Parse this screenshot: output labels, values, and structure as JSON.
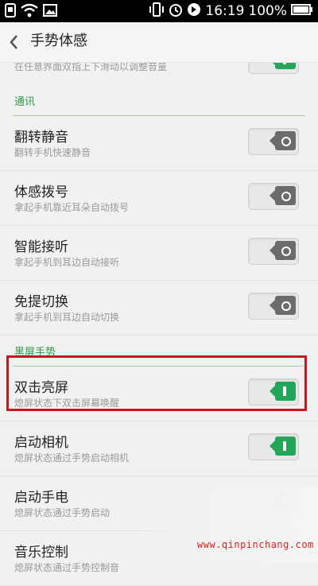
{
  "statusbar": {
    "time": "16:19",
    "battery_text": "100%"
  },
  "header": {
    "title": "手势体感"
  },
  "partial_row": {
    "subtitle": "在任意界面双指上下滑动以调整音量"
  },
  "sections": [
    {
      "label": "通讯",
      "rows": [
        {
          "title": "翻转静音",
          "subtitle": "翻转手机快速静音",
          "enabled": false
        },
        {
          "title": "体感拨号",
          "subtitle": "拿起手机靠近耳朵自动拨号",
          "enabled": false
        },
        {
          "title": "智能接听",
          "subtitle": "拿起手机到耳边自动接听",
          "enabled": false
        },
        {
          "title": "免提切换",
          "subtitle": "拿起手机到耳边自动切换",
          "enabled": false
        }
      ]
    },
    {
      "label": "黑屏手势",
      "rows": [
        {
          "title": "双击亮屏",
          "subtitle": "熄屏状态下双击屏幕唤醒",
          "enabled": true
        },
        {
          "title": "启动相机",
          "subtitle": "熄屏状态通过手势启动相机",
          "enabled": true
        },
        {
          "title": "启动手电",
          "subtitle": "熄屏状态通过手势启动",
          "enabled": true
        },
        {
          "title": "音乐控制",
          "subtitle": "熄屏状态通过手势控制音",
          "enabled": true
        }
      ]
    }
  ],
  "watermark": "www.qinpinchang.com",
  "colors": {
    "accent_green": "#23a65a",
    "highlight_red": "#c8141e",
    "section_green": "#2f9a4a"
  }
}
